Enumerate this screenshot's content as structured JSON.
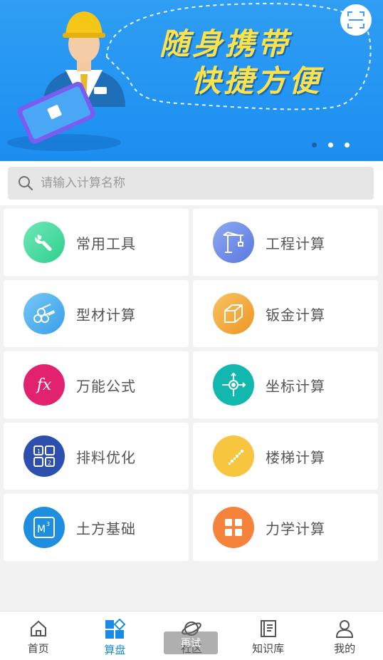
{
  "banner": {
    "slogan_line1": "随身携带",
    "slogan_line2": "快捷方便",
    "carousel_dots": 3,
    "active_dot": 0
  },
  "search": {
    "placeholder": "请输入计算名称",
    "value": ""
  },
  "tools": [
    {
      "label": "常用工具",
      "icon": "wrench-icon",
      "color": "#3fd59b"
    },
    {
      "label": "工程计算",
      "icon": "crane-icon",
      "color": "#6b8ce8"
    },
    {
      "label": "型材计算",
      "icon": "pipes-icon",
      "color": "#4ab3ee"
    },
    {
      "label": "钣金计算",
      "icon": "sheet-metal-icon",
      "color": "#f3a93b"
    },
    {
      "label": "万能公式",
      "icon": "formula-fx-icon",
      "color": "#e2226f"
    },
    {
      "label": "坐标计算",
      "icon": "coordinate-icon",
      "color": "#1bbfb6"
    },
    {
      "label": "排料优化",
      "icon": "nesting-grid-icon",
      "color": "#2c4fb0"
    },
    {
      "label": "楼梯计算",
      "icon": "stairs-icon",
      "color": "#f7c63e"
    },
    {
      "label": "土方基础",
      "icon": "cubic-meter-icon",
      "color": "#1e8fe0"
    },
    {
      "label": "力学计算",
      "icon": "squares-icon",
      "color": "#f5843a"
    }
  ],
  "nav": {
    "items": [
      {
        "label": "首页",
        "icon": "home-icon",
        "active": false
      },
      {
        "label": "算盘",
        "icon": "apps-icon",
        "active": true
      },
      {
        "label": "社区",
        "icon": "planet-icon",
        "active": false
      },
      {
        "label": "知识库",
        "icon": "book-icon",
        "active": false
      },
      {
        "label": "我的",
        "icon": "user-icon",
        "active": false
      }
    ],
    "overlay_text": "再试"
  },
  "colors": {
    "accent": "#1a8ae6",
    "banner_blue": "#1b8ef0",
    "slogan_yellow": "#ffe14a"
  }
}
